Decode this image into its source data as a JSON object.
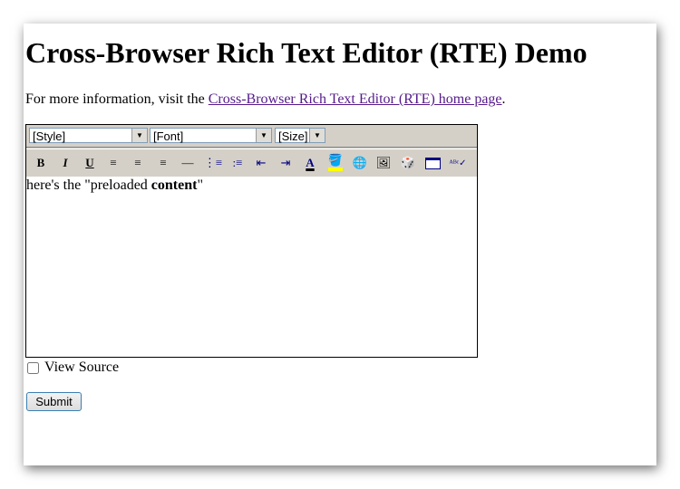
{
  "title": "Cross-Browser Rich Text Editor (RTE) Demo",
  "info": {
    "prefix": "For more information, visit the ",
    "link": "Cross-Browser Rich Text Editor (RTE) home page",
    "suffix": "."
  },
  "toolbar": {
    "style": "[Style]",
    "font": "[Font]",
    "size": "[Size]",
    "buttons": [
      "bold",
      "italic",
      "underline",
      "align-left",
      "align-center",
      "align-right",
      "horizontal-rule",
      "ordered-list",
      "unordered-list",
      "outdent",
      "indent",
      "text-color",
      "highlight-color",
      "insert-link",
      "insert-image",
      "special-character",
      "insert-table",
      "spell-check"
    ]
  },
  "content": {
    "before": "here's the \"preloaded ",
    "bold": "content",
    "after": "\""
  },
  "view_source": "View Source",
  "submit": "Submit"
}
